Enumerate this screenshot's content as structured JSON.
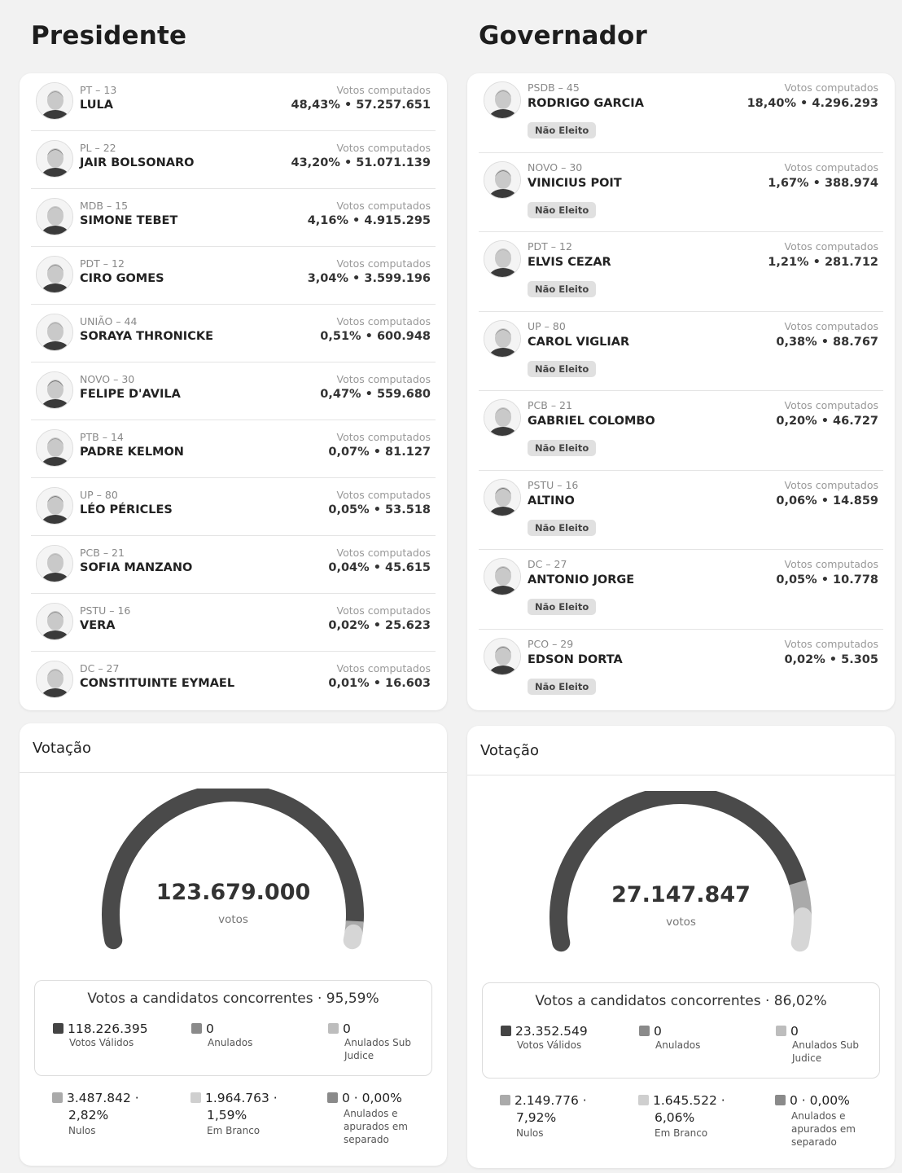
{
  "presidente": {
    "title": "Presidente",
    "votes_label": "Votos computados",
    "candidates": [
      {
        "party": "PT – 13",
        "name": "LULA",
        "votes": "48,43% • 57.257.651"
      },
      {
        "party": "PL – 22",
        "name": "JAIR BOLSONARO",
        "votes": "43,20% • 51.071.139"
      },
      {
        "party": "MDB – 15",
        "name": "SIMONE TEBET",
        "votes": "4,16% • 4.915.295"
      },
      {
        "party": "PDT – 12",
        "name": "CIRO GOMES",
        "votes": "3,04% • 3.599.196"
      },
      {
        "party": "UNIÃO – 44",
        "name": "SORAYA THRONICKE",
        "votes": "0,51% • 600.948"
      },
      {
        "party": "NOVO – 30",
        "name": "FELIPE D'AVILA",
        "votes": "0,47% • 559.680"
      },
      {
        "party": "PTB – 14",
        "name": "PADRE KELMON",
        "votes": "0,07% • 81.127"
      },
      {
        "party": "UP – 80",
        "name": "LÉO PÉRICLES",
        "votes": "0,05% • 53.518"
      },
      {
        "party": "PCB – 21",
        "name": "SOFIA MANZANO",
        "votes": "0,04% • 45.615"
      },
      {
        "party": "PSTU – 16",
        "name": "VERA",
        "votes": "0,02% • 25.623"
      },
      {
        "party": "DC – 27",
        "name": "CONSTITUINTE EYMAEL",
        "votes": "0,01% • 16.603"
      }
    ],
    "votacao": {
      "title": "Votação",
      "total": "123.679.000",
      "unit": "votos",
      "gauge_fractions": {
        "valid": 0.9559,
        "nulos": 0.0282,
        "branco": 0.0159
      },
      "valid_title": "Votos a candidatos concorrentes · 95,59%",
      "stats_top": [
        {
          "value": "118.226.395",
          "label": "Votos Válidos",
          "color": "#444444"
        },
        {
          "value": "0",
          "label": "Anulados",
          "color": "#8a8a8a"
        },
        {
          "value": "0",
          "label": "Anulados Sub Judice",
          "color": "#bdbdbd"
        }
      ],
      "stats_bottom": [
        {
          "value1": "3.487.842 ·",
          "value2": "2,82%",
          "label": "Nulos",
          "color": "#aaaaaa"
        },
        {
          "value1": "1.964.763 ·",
          "value2": "1,59%",
          "label": "Em Branco",
          "color": "#cfcfcf"
        },
        {
          "value1": "0 · 0,00%",
          "value2": "",
          "label": "Anulados e apurados em separado",
          "color": "#8a8a8a"
        }
      ]
    }
  },
  "governador": {
    "title": "Governador",
    "votes_label": "Votos computados",
    "badge": "Não Eleito",
    "candidates": [
      {
        "party": "PSDB – 45",
        "name": "RODRIGO GARCIA",
        "votes": "18,40% • 4.296.293"
      },
      {
        "party": "NOVO – 30",
        "name": "VINICIUS POIT",
        "votes": "1,67% • 388.974"
      },
      {
        "party": "PDT – 12",
        "name": "ELVIS CEZAR",
        "votes": "1,21% • 281.712"
      },
      {
        "party": "UP – 80",
        "name": "CAROL VIGLIAR",
        "votes": "0,38% • 88.767"
      },
      {
        "party": "PCB – 21",
        "name": "GABRIEL COLOMBO",
        "votes": "0,20% • 46.727"
      },
      {
        "party": "PSTU – 16",
        "name": "ALTINO",
        "votes": "0,06% • 14.859"
      },
      {
        "party": "DC – 27",
        "name": "ANTONIO JORGE",
        "votes": "0,05% • 10.778"
      },
      {
        "party": "PCO – 29",
        "name": "EDSON DORTA",
        "votes": "0,02% • 5.305"
      }
    ],
    "votacao": {
      "title": "Votação",
      "total": "27.147.847",
      "unit": "votos",
      "gauge_fractions": {
        "valid": 0.8602,
        "nulos": 0.0792,
        "branco": 0.0606
      },
      "valid_title": "Votos a candidatos concorrentes · 86,02%",
      "stats_top": [
        {
          "value": "23.352.549",
          "label": "Votos Válidos",
          "color": "#444444"
        },
        {
          "value": "0",
          "label": "Anulados",
          "color": "#8a8a8a"
        },
        {
          "value": "0",
          "label": "Anulados Sub Judice",
          "color": "#bdbdbd"
        }
      ],
      "stats_bottom": [
        {
          "value1": "2.149.776 ·",
          "value2": "7,92%",
          "label": "Nulos",
          "color": "#aaaaaa"
        },
        {
          "value1": "1.645.522 ·",
          "value2": "6,06%",
          "label": "Em Branco",
          "color": "#cfcfcf"
        },
        {
          "value1": "0 · 0,00%",
          "value2": "",
          "label": "Anulados e apurados em separado",
          "color": "#8a8a8a"
        }
      ]
    }
  },
  "icons": {
    "avatar": "candidate-avatar-icon"
  }
}
